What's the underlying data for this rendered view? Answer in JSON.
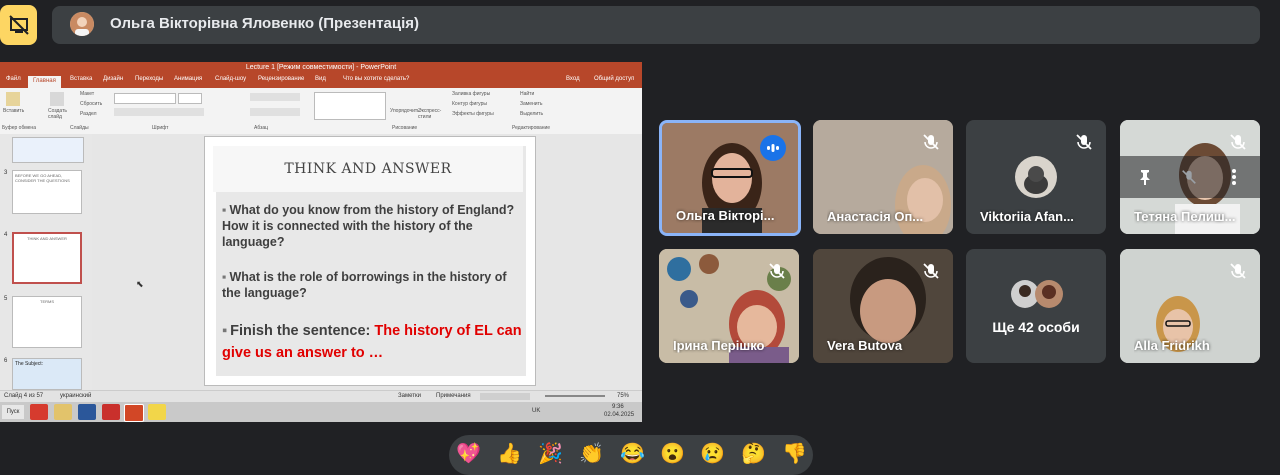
{
  "header": {
    "presenter_title": "Ольга Вікторівна Яловенко (Презентація)"
  },
  "powerpoint": {
    "window_title": "Lecture 1 [Режим совместимости] - PowerPoint",
    "tabs": [
      "Файл",
      "Главная",
      "Вставка",
      "Дизайн",
      "Переходы",
      "Анимация",
      "Слайд-шоу",
      "Рецензирование",
      "Вид",
      "Что вы хотите сделать?"
    ],
    "right_tabs": [
      "Вход",
      "Общий доступ"
    ],
    "ribbon": {
      "paste": "Вставить",
      "create_slide": "Создать слайд",
      "layout": "Макет",
      "reset": "Сбросить",
      "section": "Раздел",
      "arrange": "Упорядочить",
      "express_styles": "Экспресс-стили",
      "shape_fill": "Заливка фигуры",
      "shape_outline": "Контур фигуры",
      "shape_effects": "Эффекты фигуры",
      "find": "Найти",
      "replace": "Заменить",
      "select": "Выделить",
      "groups": [
        "Буфер обмена",
        "Слайды",
        "Шрифт",
        "Абзац",
        "Рисование",
        "Редактирование"
      ]
    },
    "thumbnails": [
      {
        "num": "3",
        "title": "BEFORE WE GO AHEAD, CONSIDER THE QUESTIONS"
      },
      {
        "num": "4",
        "title": "THINK AND ANSWER"
      },
      {
        "num": "5",
        "title": "TERMS"
      },
      {
        "num": "6",
        "title": "The Subject:"
      }
    ],
    "slide": {
      "title": "THINK AND ANSWER",
      "bullet1": "What do you know from the history of England? How it is connected with the history of the language?",
      "bullet2": "What is the role of borrowings in the history of the language?",
      "finish_prefix": "Finish the sentence:",
      "finish_red": "The history of EL can give us an answer to …"
    },
    "status": {
      "slide_info": "Слайд 4 из 57",
      "language": "украинский",
      "notes": "Заметки",
      "comments": "Примечания",
      "zoom": "75%"
    },
    "taskbar": {
      "start": "Пуск",
      "lang": "UK",
      "time": "9:36",
      "date": "02.04.2025"
    }
  },
  "participants": [
    {
      "name": "Ольга Вікторі...",
      "speaking": true
    },
    {
      "name": "Анастасія Оп...",
      "muted": true
    },
    {
      "name": "Viktoriia Afan...",
      "muted": true
    },
    {
      "name": "Тетяна Пелиш...",
      "muted": true
    },
    {
      "name": "Ірина Перішко",
      "muted": true
    },
    {
      "name": "Vera Butova",
      "muted": true
    },
    {
      "name": "Ще 42 особи"
    },
    {
      "name": "Alla Fridrikh",
      "muted": true
    }
  ],
  "reactions": [
    "💖",
    "👍",
    "🎉",
    "👏",
    "😂",
    "😮",
    "😢",
    "🤔",
    "👎"
  ],
  "colors": {
    "exit_button": "#fdd663",
    "speaking": "#1a73e8",
    "ppt_brand": "#b7472a",
    "finish_red": "#e10000"
  }
}
